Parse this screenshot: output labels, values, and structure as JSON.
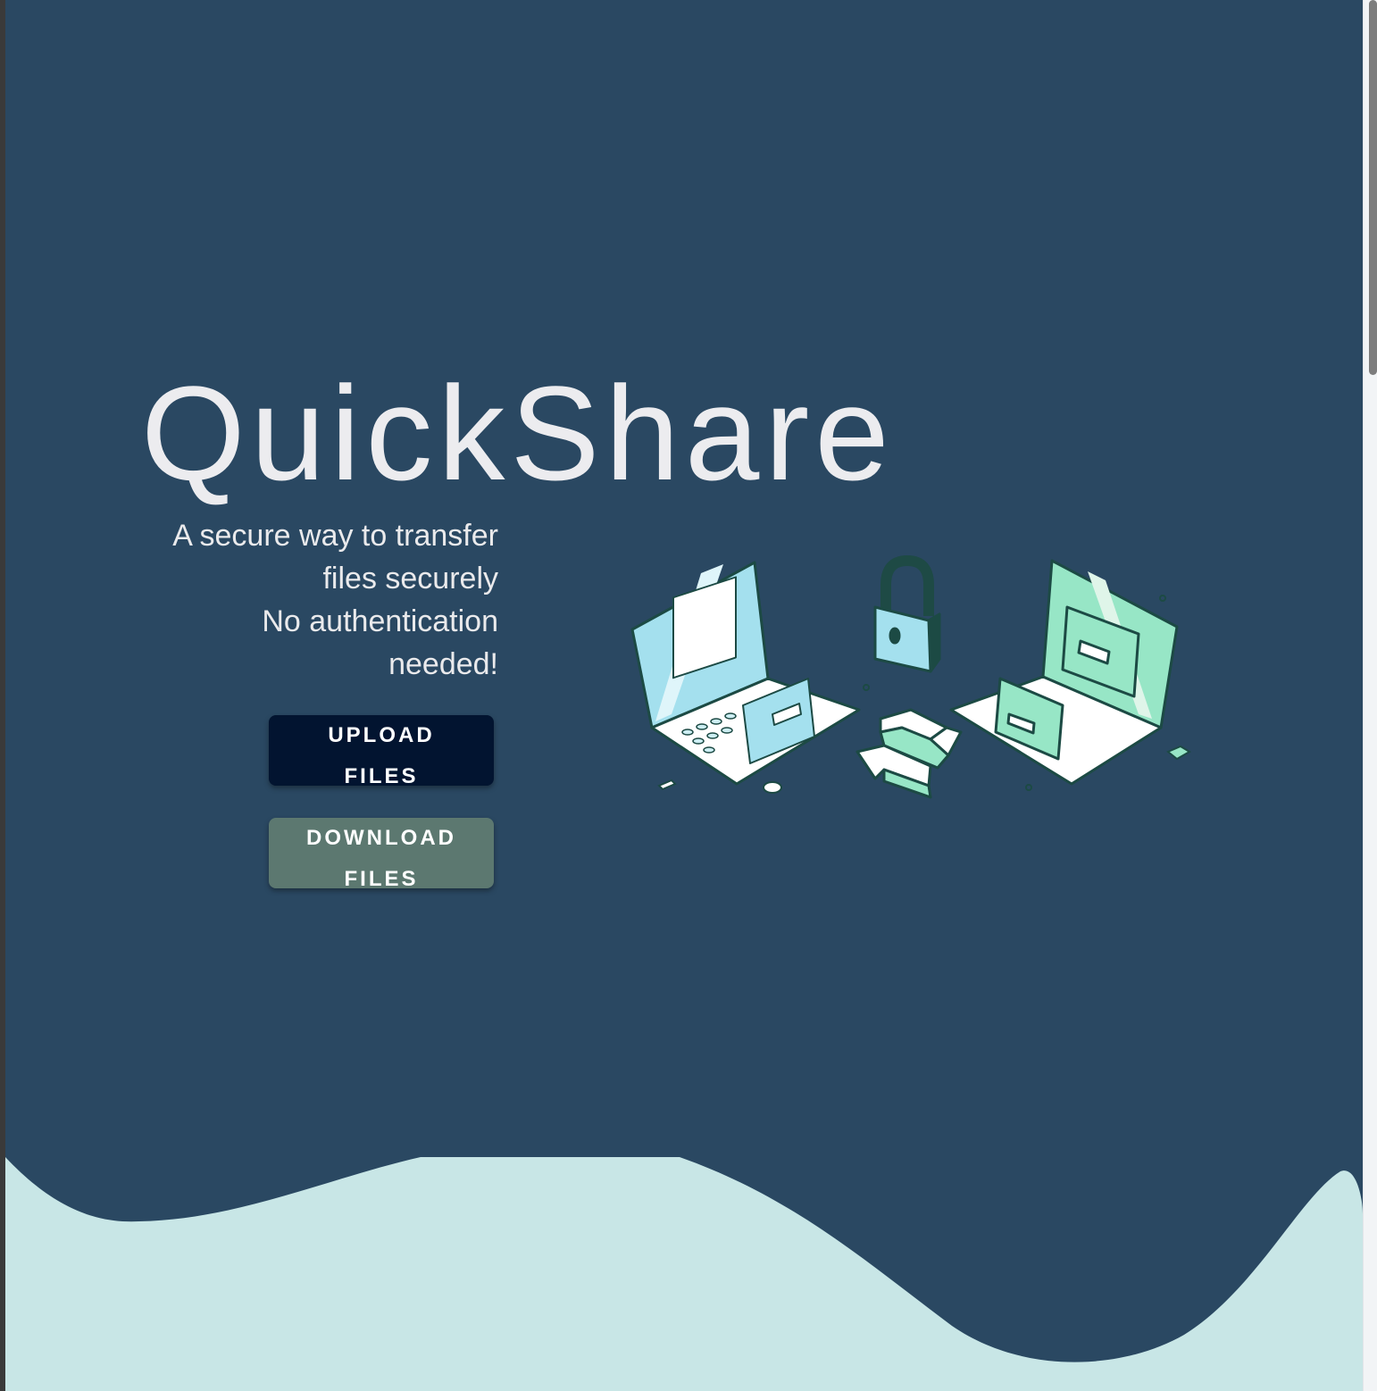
{
  "app": {
    "title": "QuickShare",
    "tagline": [
      "A secure way to transfer",
      "files securely",
      "No authentication",
      "needed!"
    ]
  },
  "actions": {
    "upload": [
      "UPLOAD",
      "FILES"
    ],
    "download": [
      "DOWNLOAD",
      "FILES"
    ]
  },
  "illustration": {
    "icons": [
      "laptop-icon",
      "padlock-icon",
      "transfer-arrows-icon",
      "folder-icon"
    ]
  },
  "colors": {
    "background": "#2a4862",
    "wave": "#c8e6e6",
    "upload_button": "#021430",
    "download_button": "#5c7870",
    "text": "#ececef",
    "accent_blue": "#a4e0ee",
    "accent_green": "#97e6c6"
  }
}
